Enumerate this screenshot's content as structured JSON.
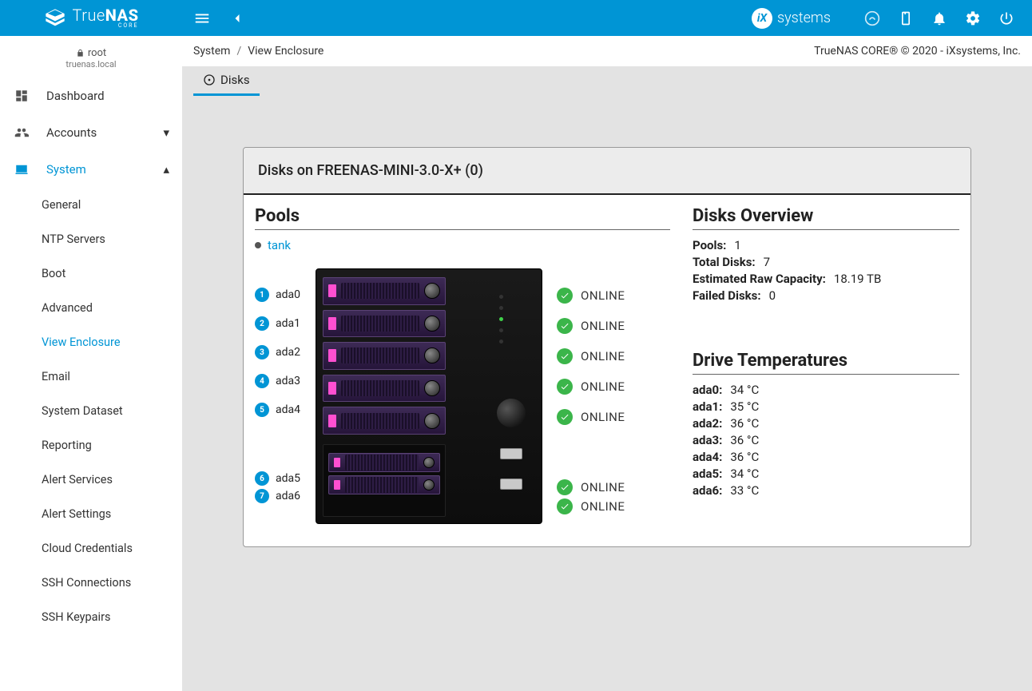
{
  "brand": {
    "name": "TrueNAS",
    "edition": "CORE"
  },
  "ix_logo_text": "systems",
  "user": {
    "name": "root",
    "host": "truenas.local"
  },
  "nav": {
    "dashboard": "Dashboard",
    "accounts": "Accounts",
    "system": "System",
    "subs": {
      "general": "General",
      "ntp": "NTP Servers",
      "boot": "Boot",
      "advanced": "Advanced",
      "view_enclosure": "View Enclosure",
      "email": "Email",
      "system_dataset": "System Dataset",
      "reporting": "Reporting",
      "alert_services": "Alert Services",
      "alert_settings": "Alert Settings",
      "cloud_credentials": "Cloud Credentials",
      "ssh_connections": "SSH Connections",
      "ssh_keypairs": "SSH Keypairs"
    }
  },
  "breadcrumb": {
    "root": "System",
    "page": "View Enclosure"
  },
  "copyright": "TrueNAS CORE® © 2020 - iXsystems, Inc.",
  "tab": {
    "disks": "Disks"
  },
  "card": {
    "title": "Disks on FREENAS-MINI-3.0-X+ (0)",
    "pools_heading": "Pools",
    "pool_name": "tank",
    "disks": [
      {
        "n": "1",
        "name": "ada0",
        "status": "ONLINE"
      },
      {
        "n": "2",
        "name": "ada1",
        "status": "ONLINE"
      },
      {
        "n": "3",
        "name": "ada2",
        "status": "ONLINE"
      },
      {
        "n": "4",
        "name": "ada3",
        "status": "ONLINE"
      },
      {
        "n": "5",
        "name": "ada4",
        "status": "ONLINE"
      },
      {
        "n": "6",
        "name": "ada5",
        "status": "ONLINE"
      },
      {
        "n": "7",
        "name": "ada6",
        "status": "ONLINE"
      }
    ],
    "overview_heading": "Disks Overview",
    "overview": {
      "pools_label": "Pools:",
      "pools_value": "1",
      "total_disks_label": "Total Disks:",
      "total_disks_value": "7",
      "capacity_label": "Estimated Raw Capacity:",
      "capacity_value": "18.19 TB",
      "failed_label": "Failed Disks:",
      "failed_value": "0"
    },
    "temps_heading": "Drive Temperatures",
    "temps": [
      {
        "label": "ada0:",
        "value": "34 °C"
      },
      {
        "label": "ada1:",
        "value": "35 °C"
      },
      {
        "label": "ada2:",
        "value": "36 °C"
      },
      {
        "label": "ada3:",
        "value": "36 °C"
      },
      {
        "label": "ada4:",
        "value": "36 °C"
      },
      {
        "label": "ada5:",
        "value": "34 °C"
      },
      {
        "label": "ada6:",
        "value": "33 °C"
      }
    ]
  }
}
